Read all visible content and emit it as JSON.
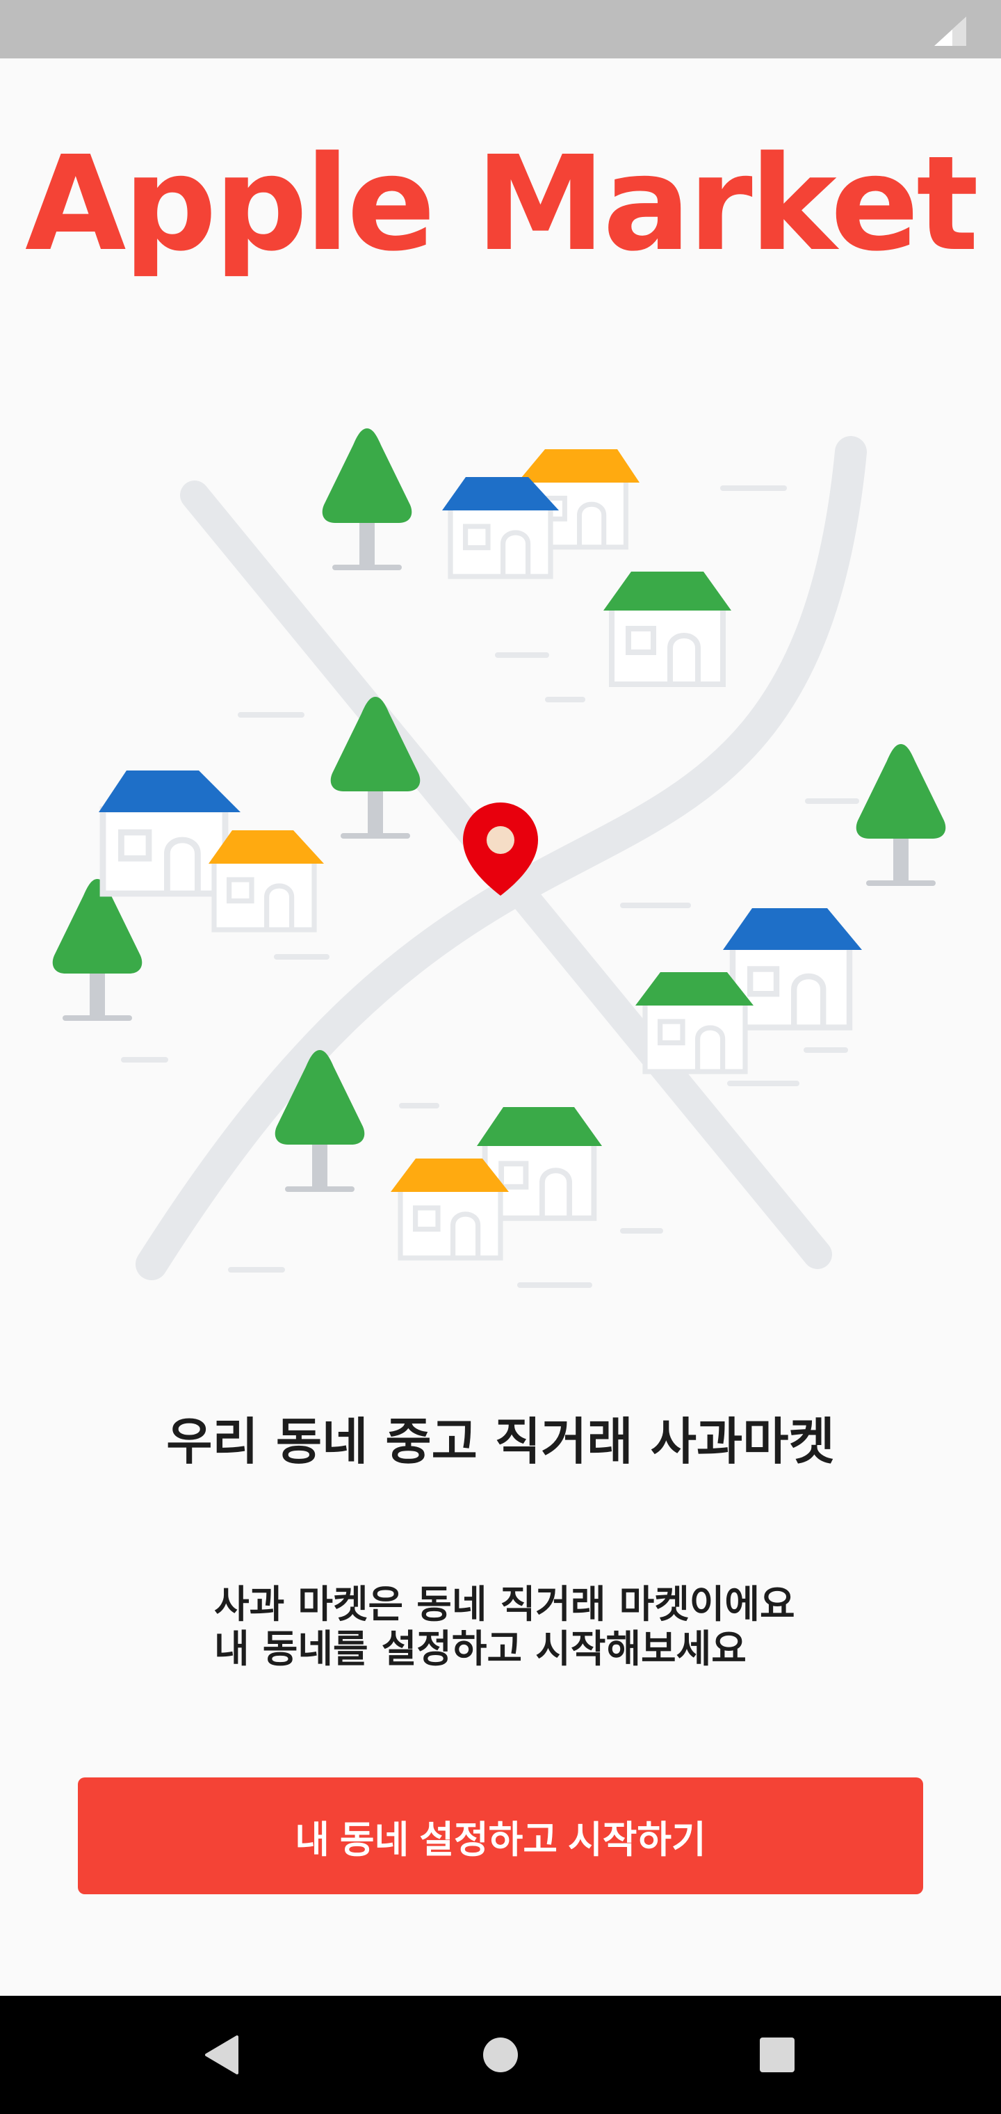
{
  "status_bar": {
    "icons": [
      "signal-icon"
    ]
  },
  "app": {
    "title": "Apple Market"
  },
  "illustration": {
    "icons": [
      "map-pin-icon",
      "house-icon",
      "tree-icon"
    ],
    "colors": {
      "pin": "#e8000d",
      "road": "#e6e8eb",
      "tree": "#3aaa48",
      "house_blue": "#1e6fc8",
      "house_orange": "#ffaa10",
      "house_green": "#3aaa48"
    }
  },
  "main": {
    "headline": "우리 동네 중고 직거래 사과마켓",
    "description_line1": "사과 마켓은 동네 직거래 마켓이에요",
    "description_line2": "내 동네를 설정하고 시작해보세요",
    "cta_label": "내 동네 설정하고 시작하기"
  },
  "nav_bar": {
    "icons": [
      "back-icon",
      "home-icon",
      "recents-icon"
    ]
  },
  "colors": {
    "accent": "#f44336",
    "background": "#fafafa",
    "text": "#1d1d1d"
  }
}
